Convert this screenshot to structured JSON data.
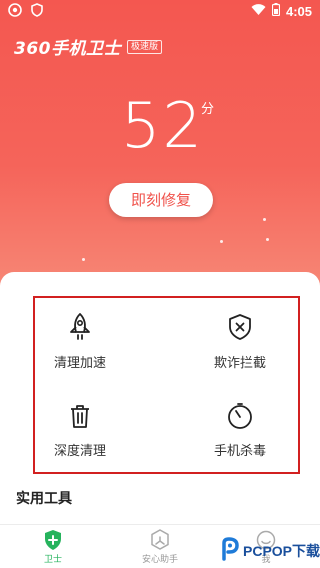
{
  "status_bar": {
    "time": "4:05",
    "icons": [
      "notification-icon",
      "shield-icon",
      "wifi-icon",
      "battery-icon"
    ]
  },
  "app": {
    "brand_name": "360手机卫士",
    "brand_tag": "极速版"
  },
  "score": {
    "value": "52",
    "unit": "分"
  },
  "repair_button": "即刻修复",
  "tools": [
    {
      "label": "清理加速",
      "icon": "rocket-icon"
    },
    {
      "label": "欺诈拦截",
      "icon": "shield-x-icon"
    },
    {
      "label": "深度清理",
      "icon": "trash-icon"
    },
    {
      "label": "手机杀毒",
      "icon": "timer-icon"
    }
  ],
  "section_title": "实用工具",
  "tabs": [
    {
      "label": "卫士",
      "active": true,
      "icon": "shield-plus-icon"
    },
    {
      "label": "安心助手",
      "active": false,
      "icon": "assistant-icon"
    },
    {
      "label": "我",
      "active": false,
      "icon": "face-icon"
    }
  ],
  "watermark": "PCPOP下载",
  "colors": {
    "hero_red": "#f45750",
    "accent_green": "#26b35d",
    "button_text": "#f0524b",
    "highlight_border": "#d22020"
  }
}
